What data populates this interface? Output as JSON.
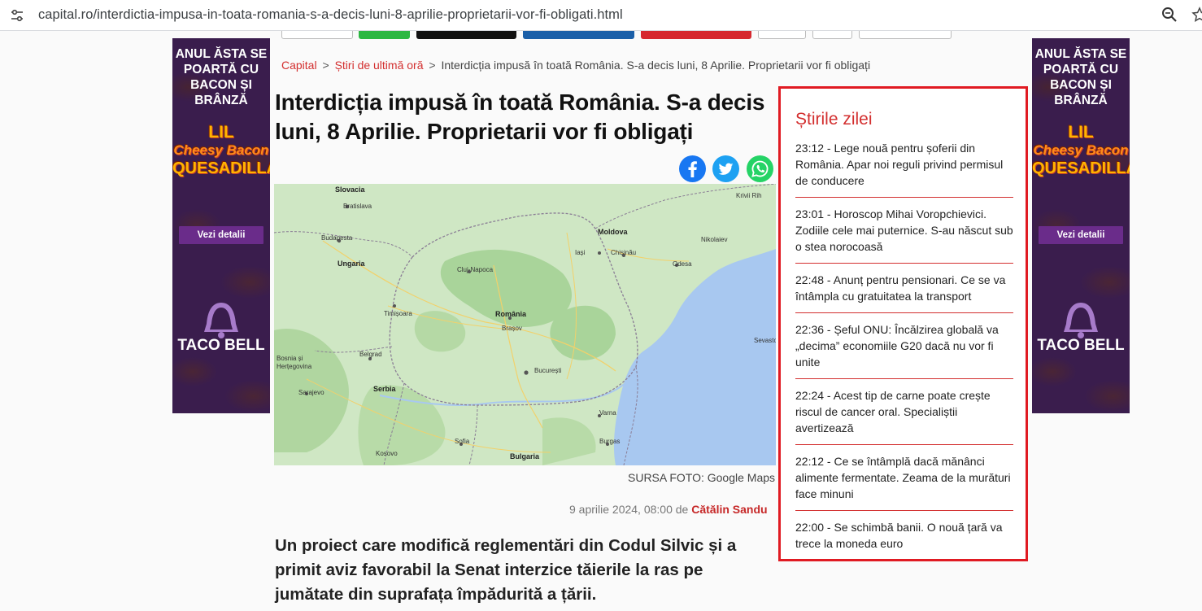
{
  "browser": {
    "url": "capital.ro/interdictia-impusa-in-toata-romania-s-a-decis-luni-8-aprilie-proprietarii-vor-fi-obligati.html"
  },
  "ad": {
    "headline": "ANUL ĂSTA SE POARTĂ CU BACON ȘI BRÂNZĂ",
    "product_line1": "LIL",
    "product_line2": "Cheesy Bacon",
    "product_line3": "QUESADILLA",
    "cta": "Vezi detalii",
    "brand": "TACO BELL"
  },
  "breadcrumb": {
    "home": "Capital",
    "section": "Știri de ultimă oră",
    "separator": ">",
    "current": "Interdicția impusă în toată România. S-a decis luni, 8 Aprilie. Proprietarii vor fi obligați"
  },
  "article": {
    "title": "Interdicția impusă în toată România. S-a decis luni, 8 Aprilie. Proprietarii vor fi obligați",
    "photo_credit": "SURSA FOTO: Google Maps",
    "date": "9 aprilie 2024, 08:00 de",
    "author": "Cătălin Sandu",
    "lead": "Un proiect care modifică reglementări din Codul Silvic și a primit aviz favorabil la Senat interzice tăierile la ras pe jumătate din suprafața împădurită a țării."
  },
  "map": {
    "labels": {
      "slovacia": "Slovacia",
      "bratislava": "Bratislava",
      "budapesta": "Budapesta",
      "ungaria": "Ungaria",
      "cluj": "Cluj-Napoca",
      "timisoara": "Timișoara",
      "romania": "România",
      "brasov": "Brașov",
      "bucuresti": "București",
      "moldova": "Moldova",
      "iasi": "Iași",
      "chisinau": "Chișinău",
      "odessa": "Odesa",
      "nikolaiev": "Nikolaiev",
      "krivoi_rih": "Krivii Rih",
      "bosnia": "Bosnia și Herțegovina",
      "sarajevo": "Sarajevo",
      "serbia": "Serbia",
      "belgrad": "Belgrad",
      "sofia": "Sofia",
      "bulgaria": "Bulgaria",
      "varna": "Varna",
      "burgas": "Burgas",
      "kosovo": "Kosovo",
      "sevastopol": "Sevastopol"
    }
  },
  "sidebar": {
    "title": "Știrile zilei",
    "items": [
      "23:12 - Lege nouă pentru șoferii din România. Apar noi reguli privind permisul de conducere",
      "23:01 - Horoscop Mihai Voropchievici. Zodiile cele mai puternice. S-au născut sub o stea norocoasă",
      "22:48 - Anunț pentru pensionari. Ce se va întâmpla cu gratuitatea la transport",
      "22:36 - Șeful ONU: Încălzirea globală va „decima” economiile G20 dacă nu vor fi unite",
      "22:24 - Acest tip de carne poate crește riscul de cancer oral. Specialiștii avertizează",
      "22:12 - Ce se întâmplă dacă mănânci alimente fermentate. Zeama de la murături face minuni",
      "22:00 - Se schimbă banii. O nouă țară va trece la moneda euro"
    ]
  },
  "colors": {
    "accent": "#d32f2f",
    "facebook": "#1877f2",
    "twitter": "#1da1f2",
    "whatsapp": "#25d366"
  }
}
